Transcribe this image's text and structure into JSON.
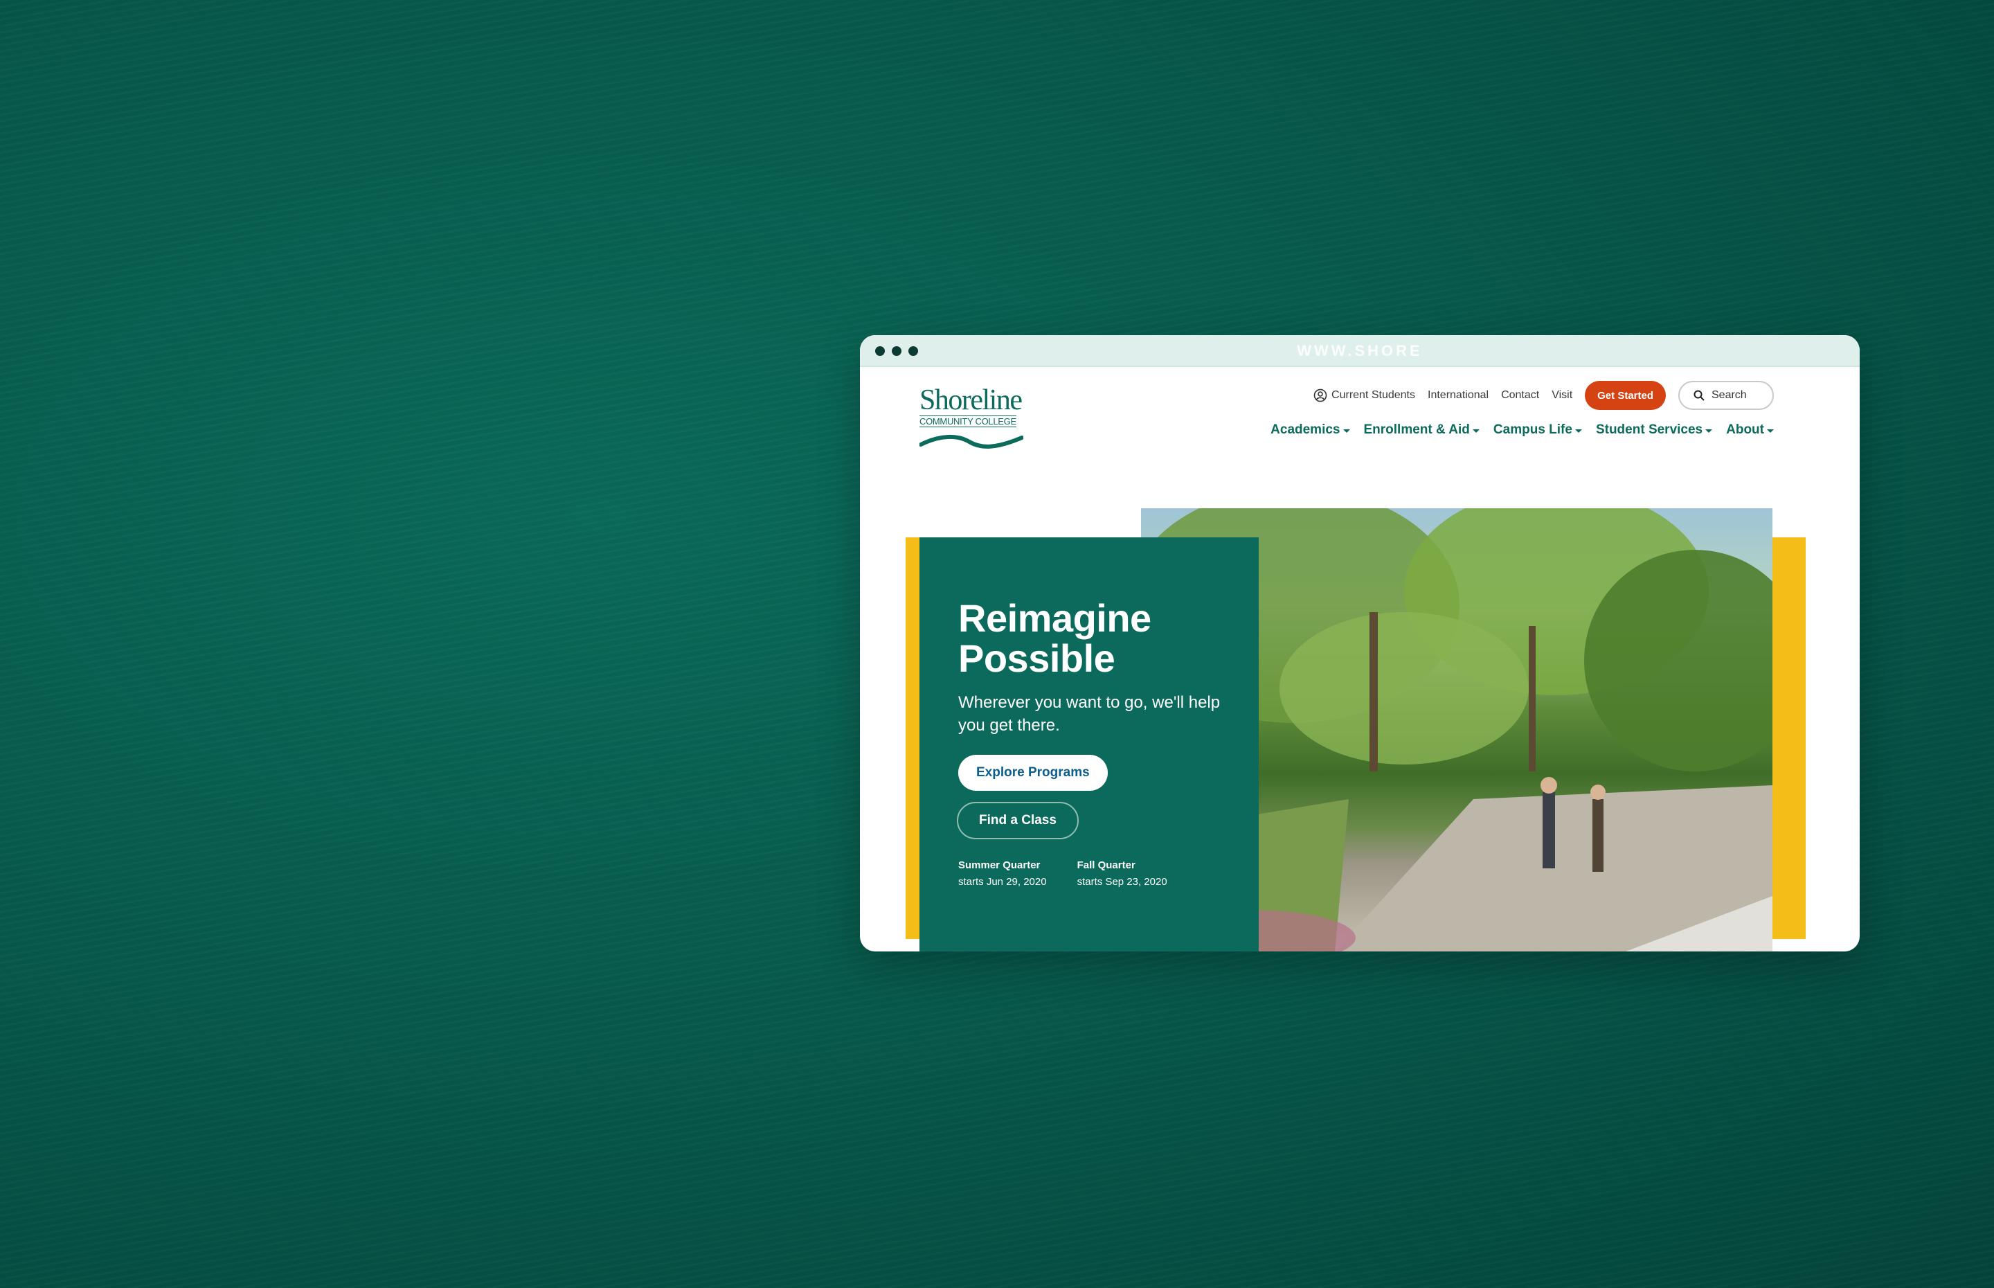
{
  "browser": {
    "url_text": "WWW.SHORE"
  },
  "logo": {
    "name": "Shoreline",
    "subtitle": "COMMUNITY COLLEGE"
  },
  "utility_nav": {
    "current_students": "Current Students",
    "international": "International",
    "contact": "Contact",
    "visit": "Visit",
    "get_started": "Get Started",
    "search_label": "Search"
  },
  "main_nav": [
    {
      "label": "Academics"
    },
    {
      "label": "Enrollment & Aid"
    },
    {
      "label": "Campus Life"
    },
    {
      "label": "Student Services"
    },
    {
      "label": "About"
    }
  ],
  "hero": {
    "title_line1": "Reimagine",
    "title_line2": "Possible",
    "subtitle": "Wherever you want to go, we'll help you get there.",
    "primary_cta": "Explore Programs",
    "secondary_cta": "Find a Class",
    "quarters": [
      {
        "name": "Summer Quarter",
        "start": "starts Jun 29, 2020"
      },
      {
        "name": "Fall Quarter",
        "start": "starts Sep 23, 2020"
      }
    ]
  },
  "colors": {
    "brand_green": "#0b6a5b",
    "accent_orange": "#d64312",
    "accent_yellow": "#f4bd18",
    "link_blue": "#0b5f8a"
  }
}
